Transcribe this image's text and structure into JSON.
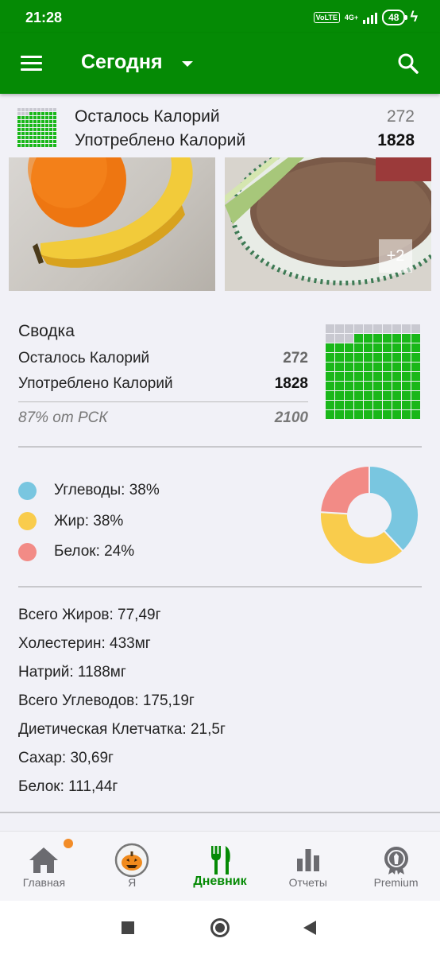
{
  "status_bar": {
    "time": "21:28",
    "volte": "Vo LTE",
    "network": "4G+",
    "battery": "48"
  },
  "app_bar": {
    "title": "Сегодня"
  },
  "calorie_header": {
    "remaining_label": "Осталось Калорий",
    "remaining_value": "272",
    "consumed_label": "Употреблено Калорий",
    "consumed_value": "1828"
  },
  "photos": {
    "more_badge": "+2"
  },
  "summary": {
    "title": "Сводка",
    "remaining_label": "Осталось Калорий",
    "remaining_value": "272",
    "consumed_label": "Употреблено Калорий",
    "consumed_value": "1828",
    "percent_label": "87% от РСК",
    "goal_value": "2100",
    "grid_filled": 87,
    "grid_total": 100
  },
  "macros": [
    {
      "label": "Углеводы: 38%",
      "percent": 38,
      "color": "#79c6e0"
    },
    {
      "label": "Жир: 38%",
      "percent": 38,
      "color": "#f9cc4c"
    },
    {
      "label": "Белок: 24%",
      "percent": 24,
      "color": "#f28b86"
    }
  ],
  "nutrients": [
    "Всего Жиров: 77,49г",
    "Холестерин: 433мг",
    "Натрий: 1188мг",
    "Всего Углеводов: 175,19г",
    "Диетическая Клетчатка: 21,5г",
    "Сахар: 30,69г",
    "Белок: 111,44г"
  ],
  "bottom_nav": [
    {
      "label": "Главная",
      "icon": "home-icon"
    },
    {
      "label": "Я",
      "icon": "avatar-pumpkin-icon"
    },
    {
      "label": "Дневник",
      "icon": "fork-knife-icon",
      "active": true
    },
    {
      "label": "Отчеты",
      "icon": "bar-chart-icon"
    },
    {
      "label": "Premium",
      "icon": "premium-badge-icon"
    }
  ],
  "colors": {
    "brand_green": "#058a05",
    "grid_filled": "#19b719",
    "grid_empty": "#c9c9d1",
    "background": "#f1f1f7"
  }
}
